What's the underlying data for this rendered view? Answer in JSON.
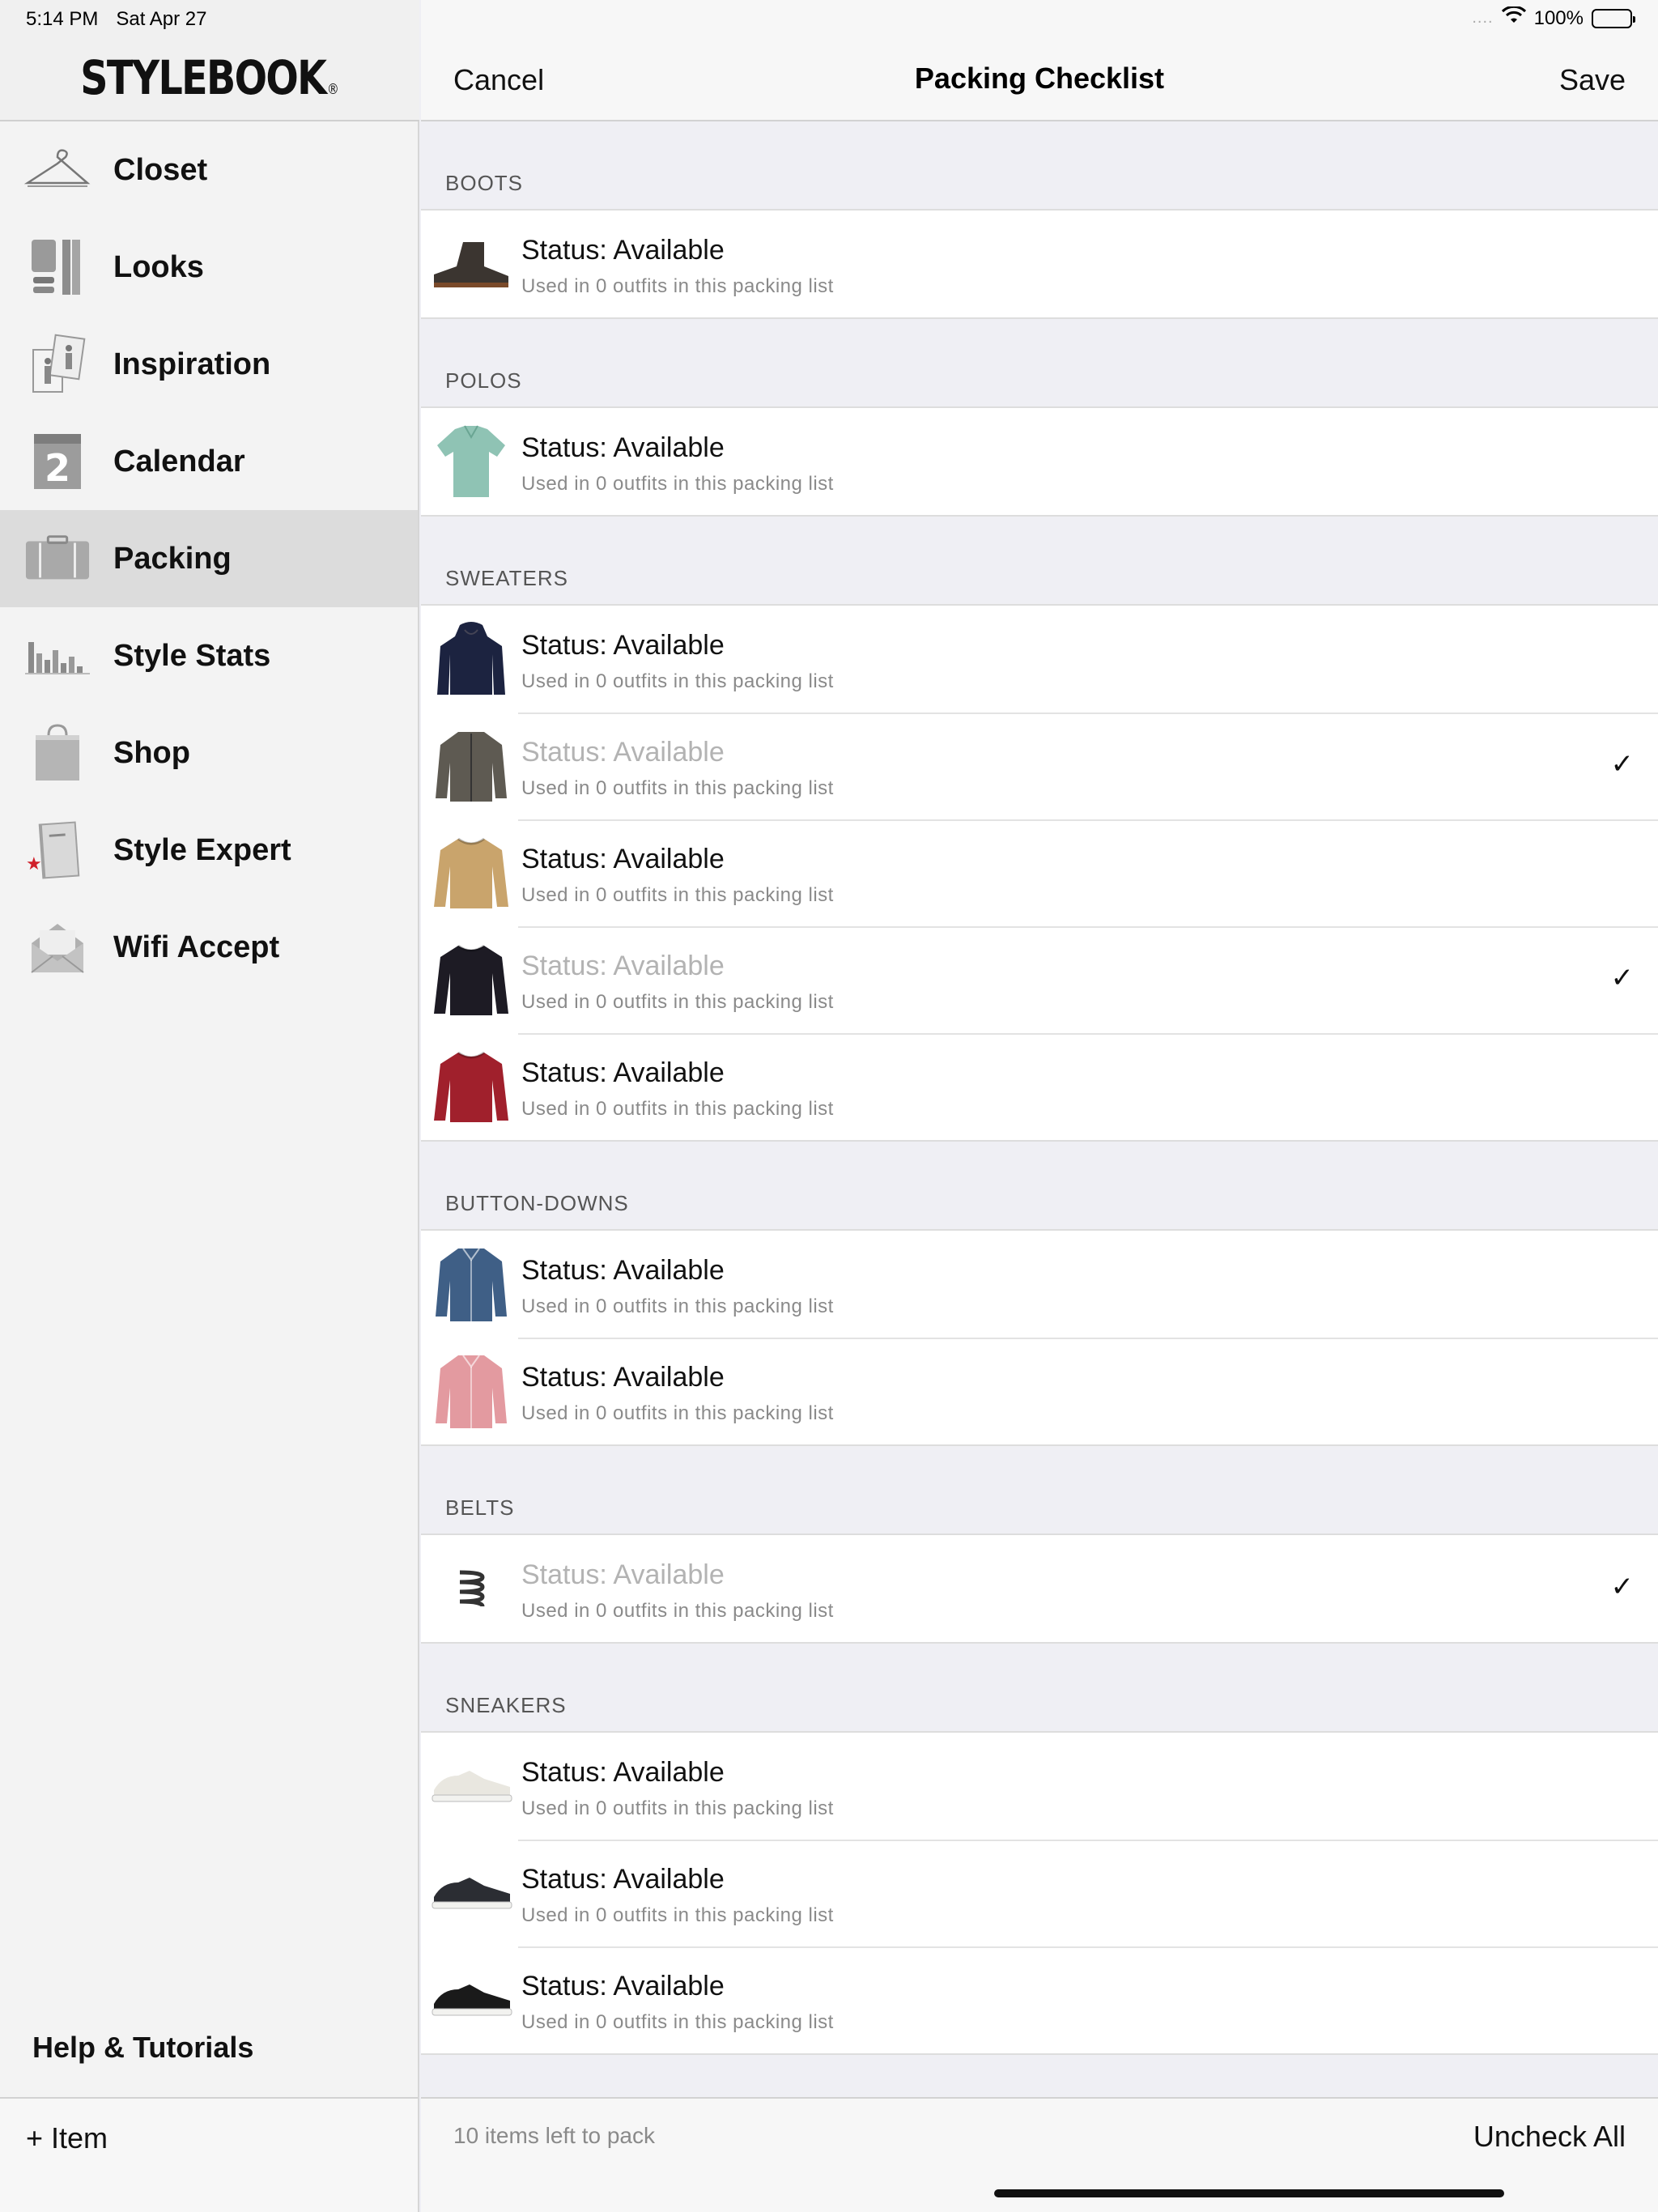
{
  "status_bar": {
    "time": "5:14 PM",
    "date": "Sat Apr 27",
    "signal": "....",
    "battery": "100%"
  },
  "brand": {
    "logo_text": "STYLEBOOK",
    "registered": "®"
  },
  "sidebar": {
    "items": [
      {
        "label": "Closet",
        "icon": "hanger-icon"
      },
      {
        "label": "Looks",
        "icon": "looks-icon"
      },
      {
        "label": "Inspiration",
        "icon": "inspiration-icon"
      },
      {
        "label": "Calendar",
        "icon": "calendar-icon"
      },
      {
        "label": "Packing",
        "icon": "suitcase-icon",
        "active": true
      },
      {
        "label": "Style Stats",
        "icon": "bar-chart-icon"
      },
      {
        "label": "Shop",
        "icon": "shopping-bag-icon"
      },
      {
        "label": "Style Expert",
        "icon": "book-icon"
      },
      {
        "label": "Wifi Accept",
        "icon": "envelope-icon"
      }
    ],
    "calendar_day": "2",
    "help_label": "Help & Tutorials",
    "add_item_label": "+ Item"
  },
  "header": {
    "cancel": "Cancel",
    "title": "Packing Checklist",
    "save": "Save"
  },
  "sections": [
    {
      "title": "BOOTS",
      "items": [
        {
          "status": "Status: Available",
          "sub": "Used in 0 outfits in this packing list",
          "checked": false,
          "thumb": "boot",
          "color": "#3b3530"
        }
      ]
    },
    {
      "title": "POLOS",
      "items": [
        {
          "status": "Status: Available",
          "sub": "Used in 0 outfits in this packing list",
          "checked": false,
          "thumb": "polo",
          "color": "#8fc3b4"
        }
      ]
    },
    {
      "title": "SWEATERS",
      "items": [
        {
          "status": "Status: Available",
          "sub": "Used in 0 outfits in this packing list",
          "checked": false,
          "thumb": "hoodie",
          "color": "#1c2340"
        },
        {
          "status": "Status: Available",
          "sub": "Used in 0 outfits in this packing list",
          "checked": true,
          "thumb": "jacket",
          "color": "#5e5a52"
        },
        {
          "status": "Status: Available",
          "sub": "Used in 0 outfits in this packing list",
          "checked": false,
          "thumb": "sweater",
          "color": "#c9a46c"
        },
        {
          "status": "Status: Available",
          "sub": "Used in 0 outfits in this packing list",
          "checked": true,
          "thumb": "sweater",
          "color": "#1d1b24"
        },
        {
          "status": "Status: Available",
          "sub": "Used in 0 outfits in this packing list",
          "checked": false,
          "thumb": "sweater",
          "color": "#a0202c"
        }
      ]
    },
    {
      "title": "BUTTON-DOWNS",
      "items": [
        {
          "status": "Status: Available",
          "sub": "Used in 0 outfits in this packing list",
          "checked": false,
          "thumb": "shirt",
          "color": "#3f5f86"
        },
        {
          "status": "Status: Available",
          "sub": "Used in 0 outfits in this packing list",
          "checked": false,
          "thumb": "shirt",
          "color": "#e39aa0"
        }
      ]
    },
    {
      "title": "BELTS",
      "items": [
        {
          "status": "Status: Available",
          "sub": "Used in 0 outfits in this packing list",
          "checked": true,
          "thumb": "belt",
          "color": "#333333"
        }
      ]
    },
    {
      "title": "SNEAKERS",
      "items": [
        {
          "status": "Status: Available",
          "sub": "Used in 0 outfits in this packing list",
          "checked": false,
          "thumb": "sneaker",
          "color": "#e9e7e0"
        },
        {
          "status": "Status: Available",
          "sub": "Used in 0 outfits in this packing list",
          "checked": false,
          "thumb": "sneaker",
          "color": "#2b2d33"
        },
        {
          "status": "Status: Available",
          "sub": "Used in 0 outfits in this packing list",
          "checked": false,
          "thumb": "sneaker",
          "color": "#1a1a1a"
        }
      ]
    }
  ],
  "footer": {
    "items_left": "10 items left to pack",
    "uncheck_all": "Uncheck All"
  }
}
